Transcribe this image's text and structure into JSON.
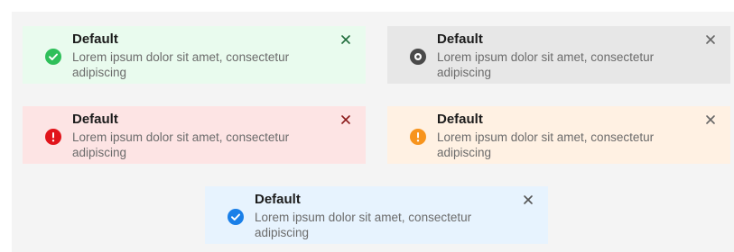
{
  "alerts": [
    {
      "kind": "success",
      "title": "Default",
      "message": "Lorem ipsum dolor sit amet, consectetur adipiscing",
      "icon": "check-circle-icon",
      "color": "#2fbf5a"
    },
    {
      "kind": "neutral",
      "title": "Default",
      "message": "Lorem ipsum dolor sit amet, consectetur adipiscing",
      "icon": "dot-circle-icon",
      "color": "#4a4a4a"
    },
    {
      "kind": "error",
      "title": "Default",
      "message": "Lorem ipsum dolor sit amet, consectetur adipiscing",
      "icon": "exclamation-circle-icon",
      "color": "#e1141b"
    },
    {
      "kind": "warning",
      "title": "Default",
      "message": "Lorem ipsum dolor sit amet, consectetur adipiscing",
      "icon": "exclamation-circle-icon",
      "color": "#f7941d"
    },
    {
      "kind": "info",
      "title": "Default",
      "message": "Lorem ipsum dolor sit amet, consectetur adipiscing",
      "icon": "check-circle-icon",
      "color": "#1a7fe8"
    }
  ]
}
